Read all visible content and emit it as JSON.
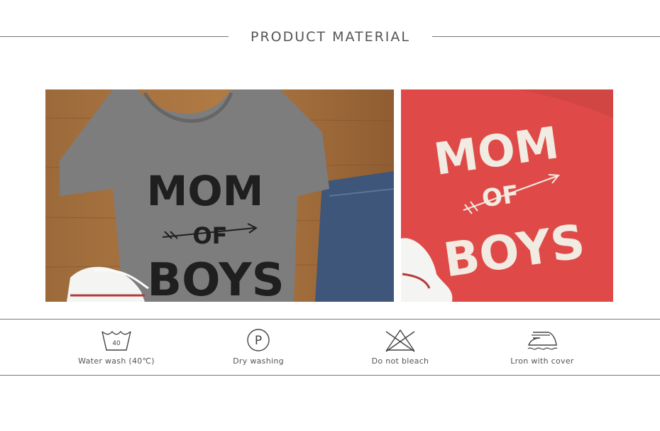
{
  "header": {
    "title": "PRODUCT MATERIAL"
  },
  "photos": [
    {
      "shirt_color": "#7d7d7e",
      "print_color": "#1f1f1f",
      "shirt_text": [
        "MOM",
        "OF",
        "BOYS"
      ]
    },
    {
      "shirt_color": "#df4a48",
      "print_color": "#f1ebe1",
      "shirt_text": [
        "MOM",
        "OF",
        "BOYS"
      ]
    }
  ],
  "care": {
    "wash_temp": "40",
    "dry_symbol": "P",
    "items": [
      {
        "icon": "wash-tub-icon",
        "label": "Water wash (40℃)"
      },
      {
        "icon": "dry-clean-icon",
        "label": "Dry washing"
      },
      {
        "icon": "no-bleach-icon",
        "label": "Do not bleach"
      },
      {
        "icon": "iron-icon",
        "label": "Lron with cover"
      }
    ]
  }
}
